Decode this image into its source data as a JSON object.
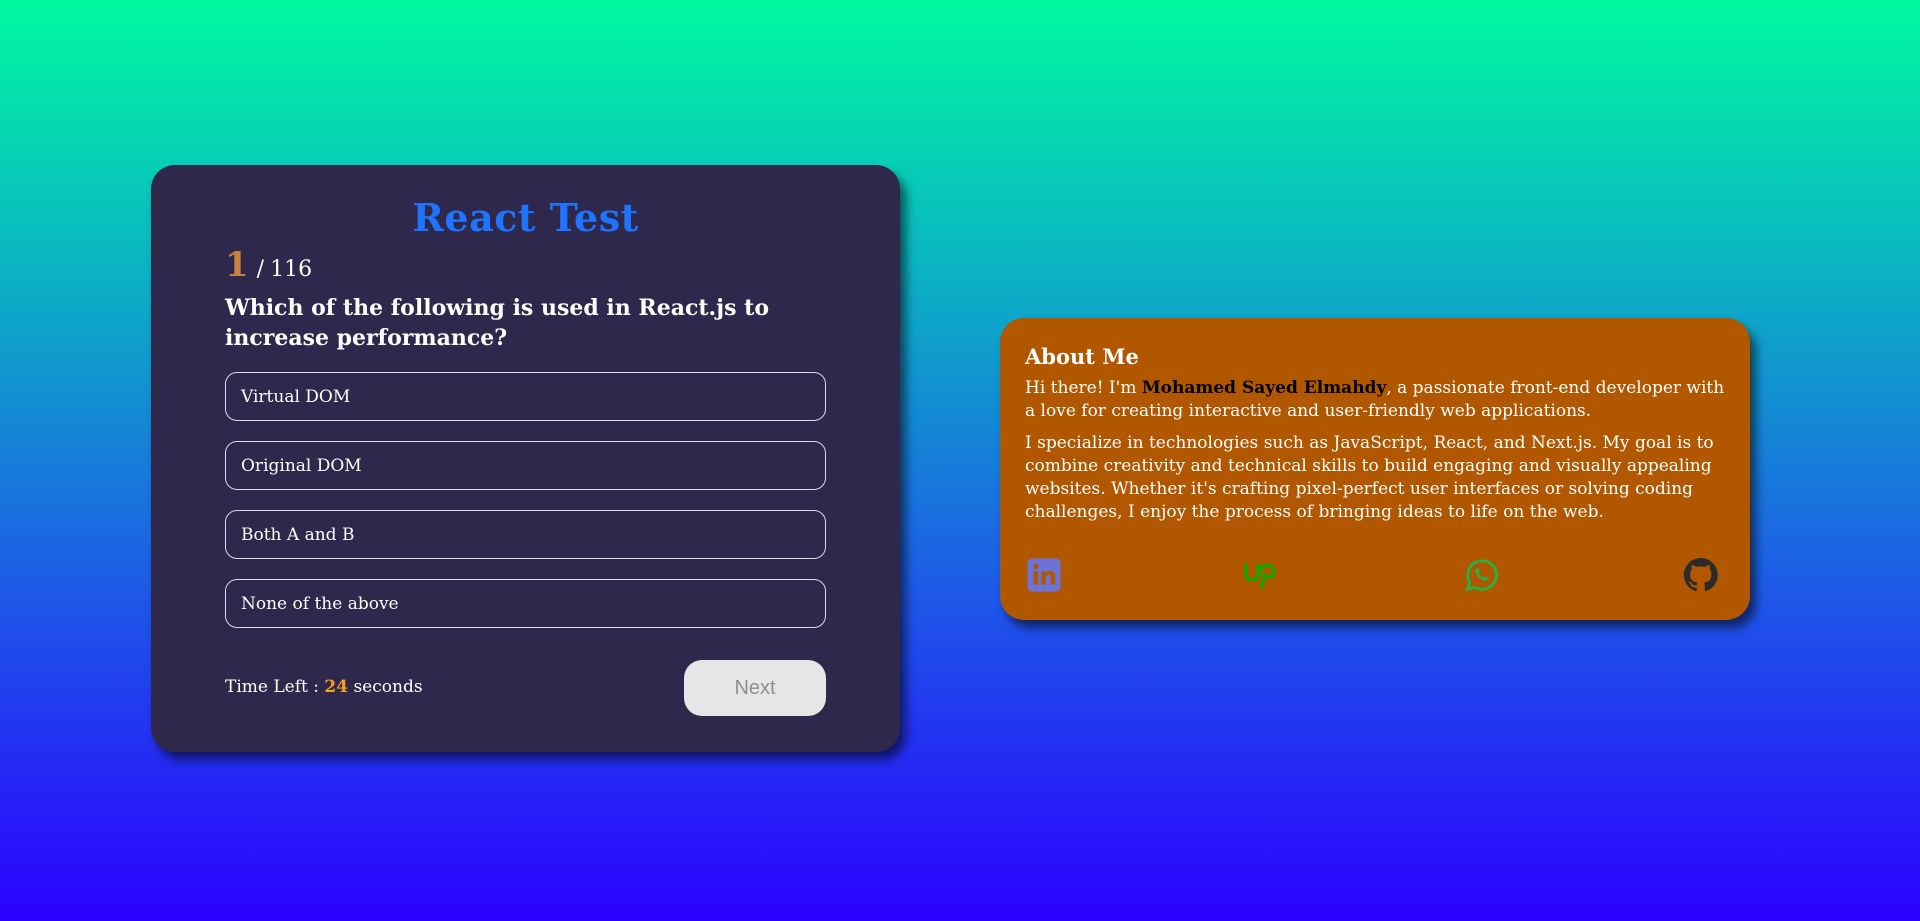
{
  "quiz": {
    "title": "React Test",
    "current": "1",
    "separator": "/",
    "total": "116",
    "question": "Which of the following is used in React.js to increase performance?",
    "options": [
      "Virtual DOM",
      "Original DOM",
      "Both A and B",
      "None of the above"
    ],
    "timer": {
      "prefix": "Time Left :",
      "value": "24",
      "suffix": "seconds"
    },
    "next_label": "Next"
  },
  "about": {
    "title": "About Me",
    "intro_before": "Hi there! I'm ",
    "name": "Mohamed Sayed Elmahdy",
    "intro_after": ", a passionate front-end developer with a love for creating interactive and user-friendly web applications.",
    "paragraph2": "I specialize in technologies such as JavaScript, React, and Next.js. My goal is to combine creativity and technical skills to build engaging and visually appealing websites. Whether it's crafting pixel-perfect user interfaces or solving coding challenges, I enjoy the process of bringing ideas to life on the web.",
    "socials": [
      {
        "icon": "linkedin-icon",
        "color": "#6b73d9"
      },
      {
        "icon": "upwork-icon",
        "color": "#14a800"
      },
      {
        "icon": "whatsapp-icon",
        "color": "#25b346"
      },
      {
        "icon": "github-icon",
        "color": "#2b2b2b"
      }
    ]
  },
  "colors": {
    "quiz_bg": "#2d284c",
    "accent_blue": "#1e74ff",
    "counter_orange": "#c8843e",
    "timer_orange": "#f7a01b",
    "about_bg": "#b05700"
  }
}
